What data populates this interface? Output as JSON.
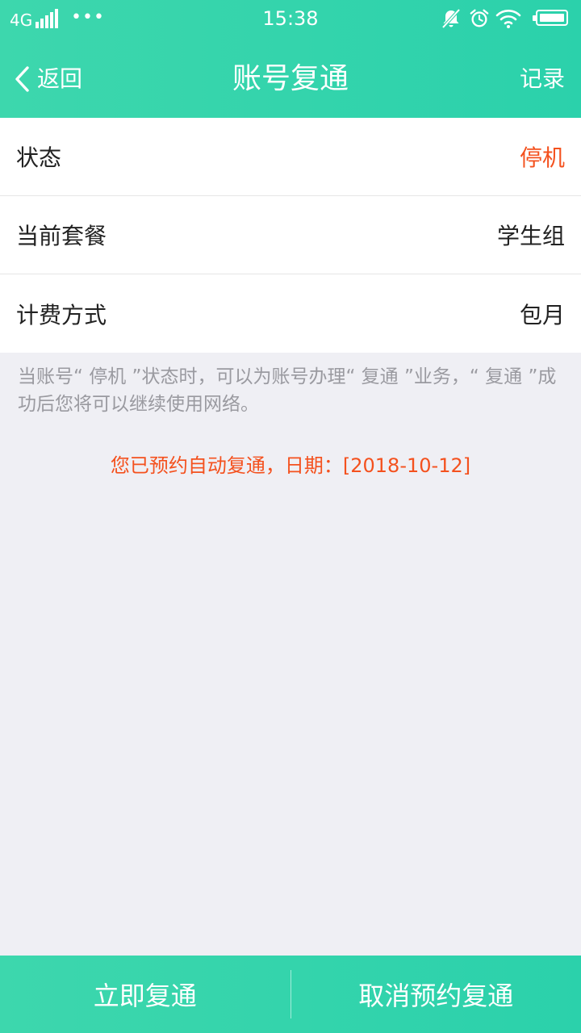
{
  "status_bar": {
    "network": "4G",
    "more_dots": "•••",
    "time": "15:38",
    "icons": [
      "signal-icon",
      "mute-icon",
      "alarm-icon",
      "wifi-icon",
      "battery-icon"
    ]
  },
  "nav": {
    "back_label": "返回",
    "title": "账号复通",
    "records_label": "记录"
  },
  "info_rows": [
    {
      "label": "状态",
      "value": "停机",
      "highlight": true
    },
    {
      "label": "当前套餐",
      "value": "学生组",
      "highlight": false
    },
    {
      "label": "计费方式",
      "value": "包月",
      "highlight": false
    }
  ],
  "note": "当账号“ 停机 ”状态时，可以为账号办理“ 复通 ”业务，“ 复通 ”成功后您将可以继续使用网络。",
  "reservation_notice": "您已预约自动复通，日期：[2018-10-12]",
  "actions": {
    "reopen_now": "立即复通",
    "cancel_reservation": "取消预约复通"
  },
  "colors": {
    "brand": "#33d3ad",
    "alert": "#f4511e",
    "background": "#efeff4"
  }
}
